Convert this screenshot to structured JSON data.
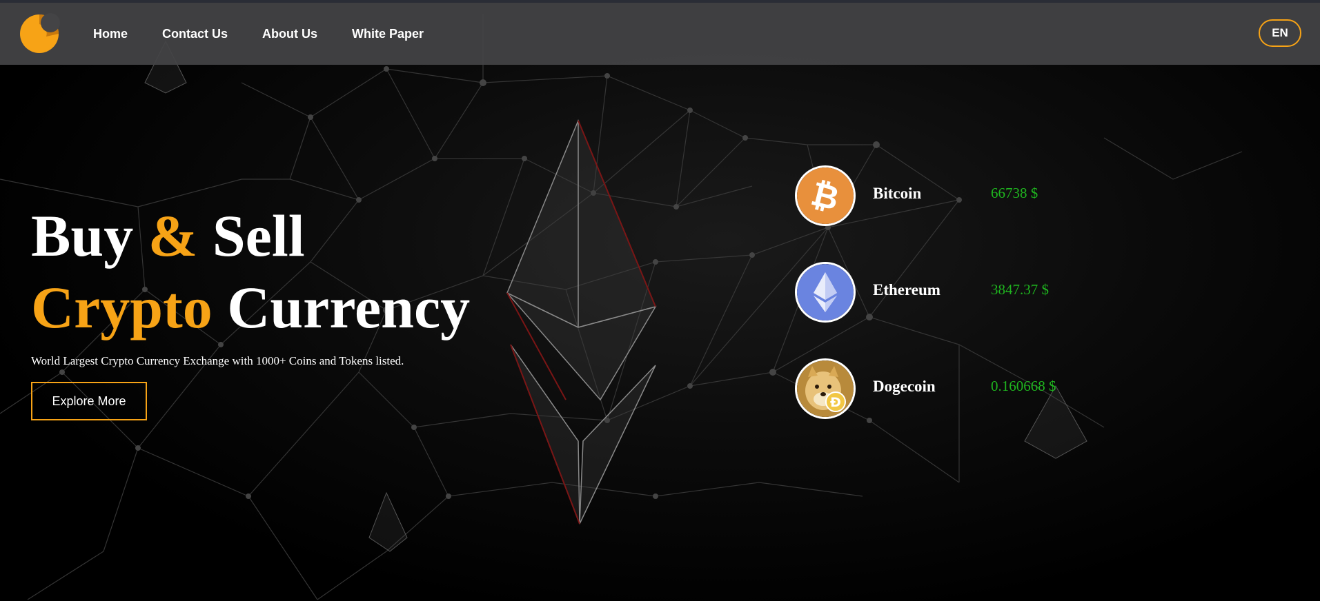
{
  "nav": {
    "items": [
      {
        "label": "Home"
      },
      {
        "label": "Contact Us"
      },
      {
        "label": "About Us"
      },
      {
        "label": "White Paper"
      }
    ],
    "language": "EN"
  },
  "hero": {
    "title_line1_part1": "Buy ",
    "title_line1_accent": "&",
    "title_line1_part2": " Sell",
    "title_line2_accent": "Crypto",
    "title_line2_part2": " Currency",
    "subtitle": "World Largest Crypto Currency Exchange with 1000+ Coins and Tokens listed.",
    "button_label": "Explore More"
  },
  "coins": [
    {
      "name": "Bitcoin",
      "price": "66738 $",
      "icon": "bitcoin-icon"
    },
    {
      "name": "Ethereum",
      "price": "3847.37 $",
      "icon": "ethereum-icon"
    },
    {
      "name": "Dogecoin",
      "price": "0.160668 $",
      "icon": "dogecoin-icon"
    }
  ],
  "colors": {
    "accent": "#f7a316",
    "price": "#1fb51f",
    "navbar": "#444446",
    "background": "#000000"
  }
}
